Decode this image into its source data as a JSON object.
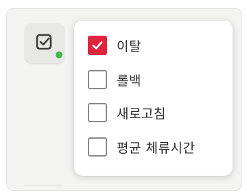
{
  "filter_button": {
    "icon": "check-square-icon",
    "status_dot_color": "#3fb950"
  },
  "options": [
    {
      "label": "이탈",
      "checked": true
    },
    {
      "label": "롤백",
      "checked": false
    },
    {
      "label": "새로고침",
      "checked": false
    },
    {
      "label": "평균 체류시간",
      "checked": false
    }
  ],
  "colors": {
    "checked": "#e0243e",
    "unchecked_border": "#8a8a8a",
    "panel_bg": "#f3f3f1",
    "dropdown_bg": "#ffffff"
  }
}
